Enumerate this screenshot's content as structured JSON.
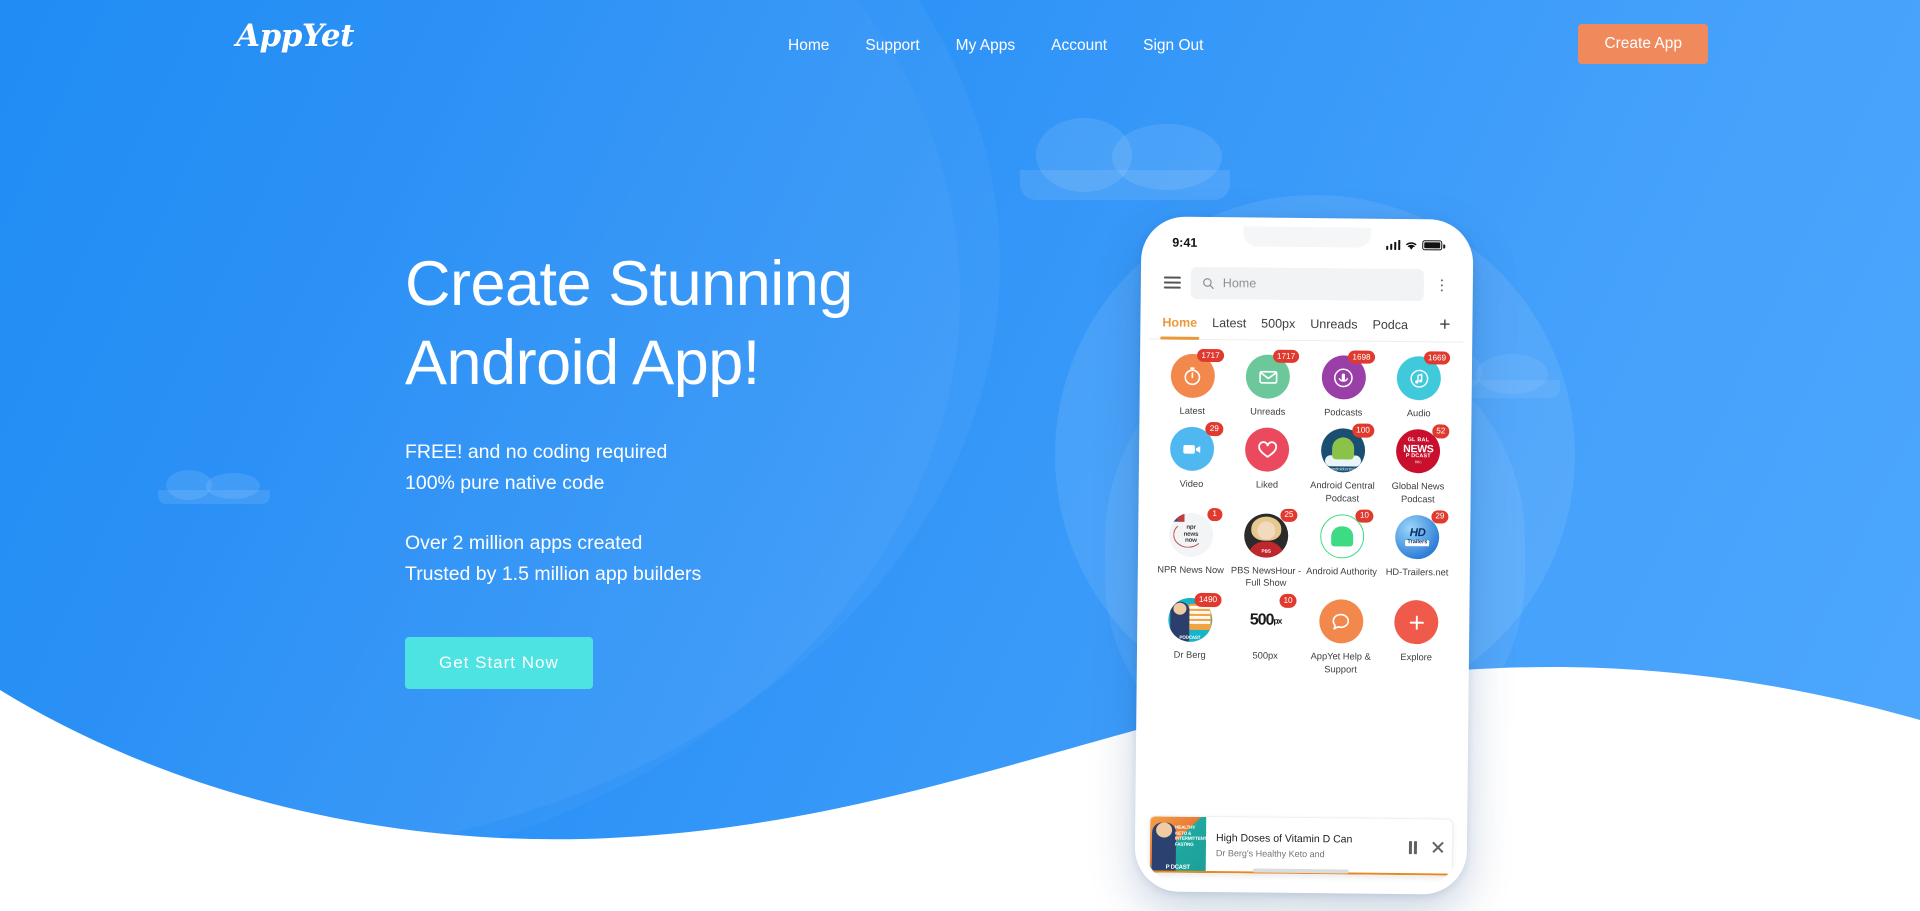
{
  "brand": {
    "logo": "AppYet"
  },
  "nav": {
    "links": [
      {
        "label": "Home"
      },
      {
        "label": "Support"
      },
      {
        "label": "My Apps"
      },
      {
        "label": "Account"
      },
      {
        "label": "Sign Out"
      }
    ],
    "cta": "Create App",
    "cta_color": "#F08A5D"
  },
  "hero": {
    "title_line1": "Create Stunning",
    "title_line2": "Android App!",
    "sub1_line1": "FREE! and no coding required",
    "sub1_line2": "100% pure native code",
    "sub2_line1": "Over 2 million apps created",
    "sub2_line2": "Trusted by 1.5 million app builders",
    "cta": "Get Start Now",
    "cta_color": "#4DE3E3",
    "bg_color": "#2f94f7"
  },
  "phone": {
    "status": {
      "time": "9:41"
    },
    "search": {
      "placeholder": "Home",
      "value": "Home"
    },
    "tabs": [
      {
        "label": "Home",
        "active": true
      },
      {
        "label": "Latest",
        "active": false
      },
      {
        "label": "500px",
        "active": false
      },
      {
        "label": "Unreads",
        "active": false
      },
      {
        "label": "Podca",
        "active": false
      }
    ],
    "tab_add": "+",
    "tab_active_color": "#E79A3C",
    "apps": [
      {
        "label": "Latest",
        "badge": "1717",
        "color": "#F2884B",
        "icon": "stopwatch-icon"
      },
      {
        "label": "Unreads",
        "badge": "1717",
        "color": "#6CC79A",
        "icon": "mail-icon"
      },
      {
        "label": "Podcasts",
        "badge": "1698",
        "color": "#9B3FA8",
        "icon": "podcast-icon"
      },
      {
        "label": "Audio",
        "badge": "1669",
        "color": "#3FC9DA",
        "icon": "audio-note-icon"
      },
      {
        "label": "Video",
        "badge": "29",
        "color": "#4FB8F0",
        "icon": "video-camera-icon"
      },
      {
        "label": "Liked",
        "badge": "",
        "color": "#EB4A5E",
        "icon": "heart-icon"
      },
      {
        "label": "Android Central Podcast",
        "badge": "100",
        "color": "#1b4f72",
        "icon": "android-central-artwork"
      },
      {
        "label": "Global News Podcast",
        "badge": "52",
        "color": "#C8102E",
        "icon": "global-news-artwork"
      },
      {
        "label": "NPR News Now",
        "badge": "1",
        "color": "#f2f4f6",
        "icon": "npr-artwork"
      },
      {
        "label": "PBS NewsHour - Full Show",
        "badge": "25",
        "color": "#2b2b2b",
        "icon": "pbs-artwork"
      },
      {
        "label": "Android Authority",
        "badge": "10",
        "color": "#3ddc84",
        "icon": "android-authority-artwork"
      },
      {
        "label": "HD-Trailers.net",
        "badge": "29",
        "color": "#2f7fd6",
        "icon": "hd-trailers-artwork"
      },
      {
        "label": "Dr Berg",
        "badge": "1490",
        "color": "#17b3c7",
        "icon": "dr-berg-artwork"
      },
      {
        "label": "500px",
        "badge": "10",
        "color": "#ffffff",
        "icon": "500px-logo"
      },
      {
        "label": "AppYet Help & Support",
        "badge": "",
        "color": "#F2884B",
        "icon": "chat-bubble-icon"
      },
      {
        "label": "Explore",
        "badge": "",
        "color": "#F05A4B",
        "icon": "plus-icon"
      }
    ],
    "artwork_text": {
      "android_central": "androidcentral",
      "global_news_l1": "GL  BAL",
      "global_news_l2": "NEWS",
      "global_news_l3": "P  DCAST",
      "global_news_l4": "BBC",
      "npr": "npr news now",
      "pbs": "PBS",
      "hd_1": "HD",
      "hd_2": "Trailers",
      "px500_num": "500",
      "px500_sup": "px",
      "dr_berg_pod": "PODCAST"
    },
    "player": {
      "title": "High Doses of Vitamin D Can",
      "subtitle": "Dr Berg's Healthy Keto and",
      "art_text": "HEALTHY KETO & INTERMITTENT FASTING",
      "art_pod": "P    DCAST",
      "progress_color": "#E8891F"
    }
  }
}
